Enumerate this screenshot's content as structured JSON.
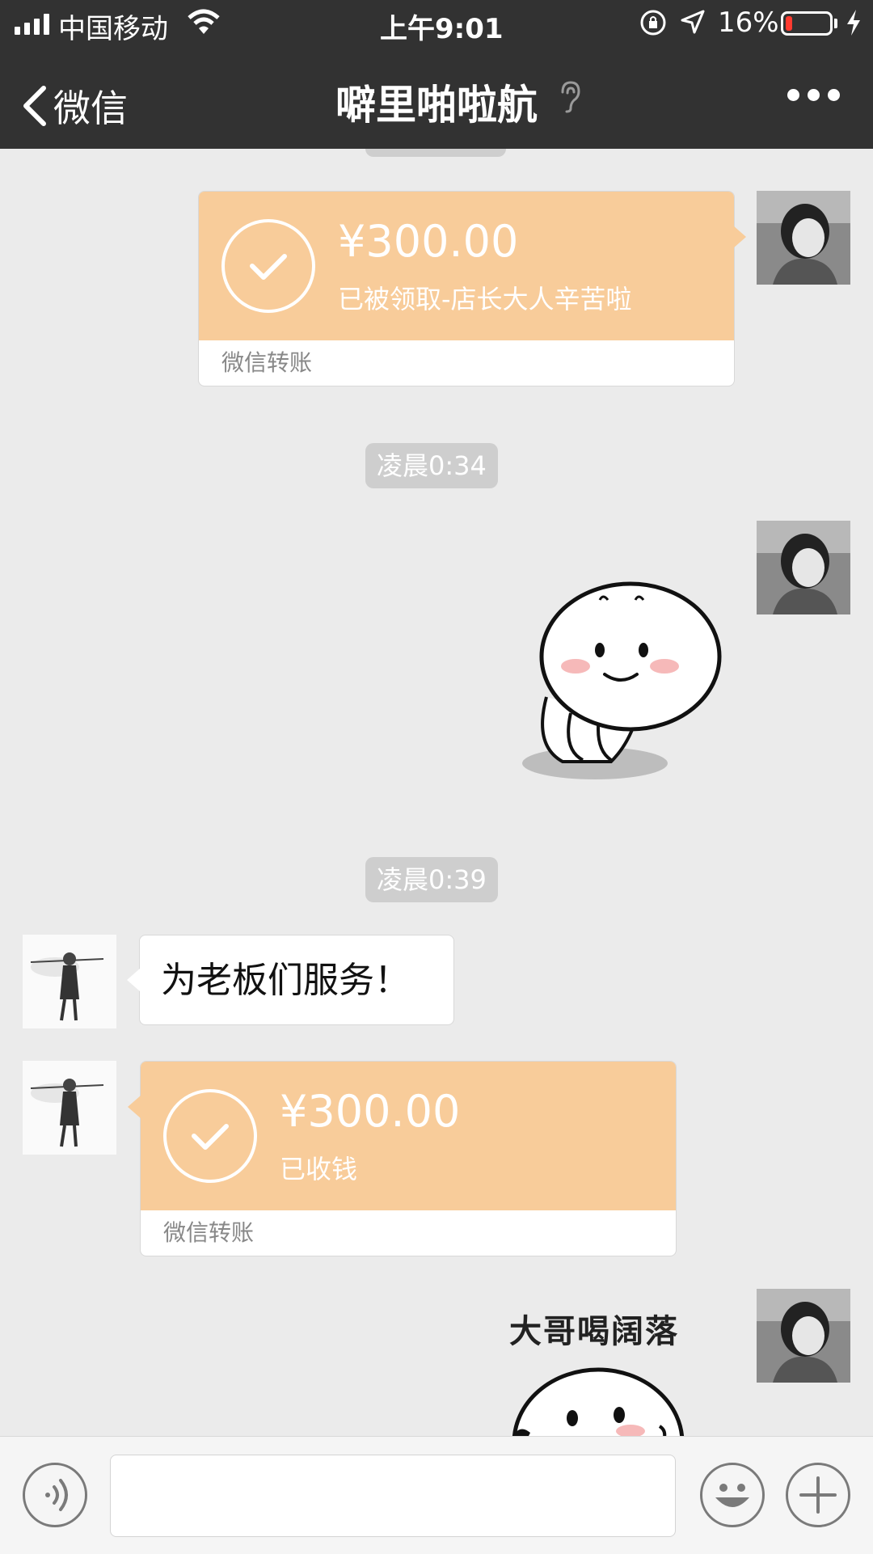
{
  "status_bar": {
    "carrier": "中国移动",
    "time": "上午9:01",
    "battery": "16%",
    "battery_level": 0.16,
    "battery_color": "#ff3b30"
  },
  "nav": {
    "back_label": "微信",
    "title": "噼里啪啦航",
    "icons": [
      "back-chevron-icon",
      "ear-icon",
      "more-icon"
    ]
  },
  "messages": [
    {
      "type": "transfer",
      "side": "right",
      "amount": "¥300.00",
      "status": "已被领取-店长大人辛苦啦",
      "footer": "微信转账"
    },
    {
      "type": "timestamp",
      "text": "凌晨0:34"
    },
    {
      "type": "sticker",
      "side": "right",
      "caption": ""
    },
    {
      "type": "timestamp",
      "text": "凌晨0:39"
    },
    {
      "type": "text",
      "side": "left",
      "text": "为老板们服务！"
    },
    {
      "type": "transfer",
      "side": "left",
      "amount": "¥300.00",
      "status": "已收钱",
      "footer": "微信转账"
    },
    {
      "type": "sticker",
      "side": "right",
      "caption": "大哥喝阔落"
    }
  ],
  "input_bar": {
    "placeholder": "",
    "icons": [
      "voice-icon",
      "emoji-icon",
      "plus-icon"
    ]
  },
  "colors": {
    "nav_bg": "#323232",
    "chat_bg": "#ebebeb",
    "transfer_bg": "#f8cc9a",
    "timestamp_pill": "#cecece"
  }
}
